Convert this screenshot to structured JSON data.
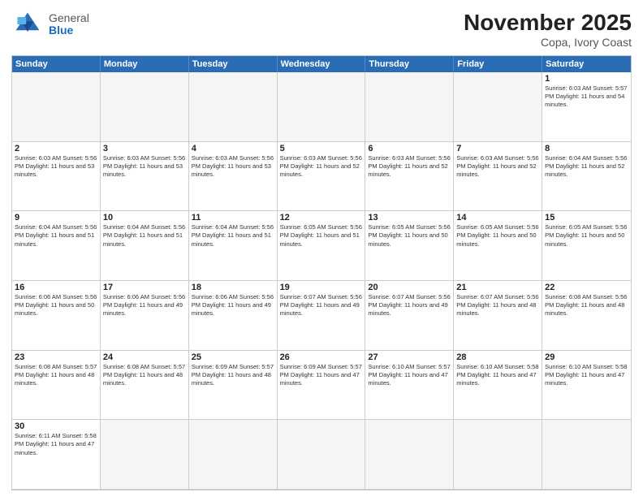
{
  "header": {
    "logo": {
      "general": "General",
      "blue": "Blue"
    },
    "title": "November 2025",
    "location": "Copa, Ivory Coast"
  },
  "days": [
    "Sunday",
    "Monday",
    "Tuesday",
    "Wednesday",
    "Thursday",
    "Friday",
    "Saturday"
  ],
  "cells": [
    {
      "day": "",
      "info": ""
    },
    {
      "day": "",
      "info": ""
    },
    {
      "day": "",
      "info": ""
    },
    {
      "day": "",
      "info": ""
    },
    {
      "day": "",
      "info": ""
    },
    {
      "day": "",
      "info": ""
    },
    {
      "day": "1",
      "info": "Sunrise: 6:03 AM\nSunset: 5:57 PM\nDaylight: 11 hours\nand 54 minutes."
    },
    {
      "day": "2",
      "info": "Sunrise: 6:03 AM\nSunset: 5:56 PM\nDaylight: 11 hours\nand 53 minutes."
    },
    {
      "day": "3",
      "info": "Sunrise: 6:03 AM\nSunset: 5:56 PM\nDaylight: 11 hours\nand 53 minutes."
    },
    {
      "day": "4",
      "info": "Sunrise: 6:03 AM\nSunset: 5:56 PM\nDaylight: 11 hours\nand 53 minutes."
    },
    {
      "day": "5",
      "info": "Sunrise: 6:03 AM\nSunset: 5:56 PM\nDaylight: 11 hours\nand 52 minutes."
    },
    {
      "day": "6",
      "info": "Sunrise: 6:03 AM\nSunset: 5:56 PM\nDaylight: 11 hours\nand 52 minutes."
    },
    {
      "day": "7",
      "info": "Sunrise: 6:03 AM\nSunset: 5:56 PM\nDaylight: 11 hours\nand 52 minutes."
    },
    {
      "day": "8",
      "info": "Sunrise: 6:04 AM\nSunset: 5:56 PM\nDaylight: 11 hours\nand 52 minutes."
    },
    {
      "day": "9",
      "info": "Sunrise: 6:04 AM\nSunset: 5:56 PM\nDaylight: 11 hours\nand 51 minutes."
    },
    {
      "day": "10",
      "info": "Sunrise: 6:04 AM\nSunset: 5:56 PM\nDaylight: 11 hours\nand 51 minutes."
    },
    {
      "day": "11",
      "info": "Sunrise: 6:04 AM\nSunset: 5:56 PM\nDaylight: 11 hours\nand 51 minutes."
    },
    {
      "day": "12",
      "info": "Sunrise: 6:05 AM\nSunset: 5:56 PM\nDaylight: 11 hours\nand 51 minutes."
    },
    {
      "day": "13",
      "info": "Sunrise: 6:05 AM\nSunset: 5:56 PM\nDaylight: 11 hours\nand 50 minutes."
    },
    {
      "day": "14",
      "info": "Sunrise: 6:05 AM\nSunset: 5:56 PM\nDaylight: 11 hours\nand 50 minutes."
    },
    {
      "day": "15",
      "info": "Sunrise: 6:05 AM\nSunset: 5:56 PM\nDaylight: 11 hours\nand 50 minutes."
    },
    {
      "day": "16",
      "info": "Sunrise: 6:06 AM\nSunset: 5:56 PM\nDaylight: 11 hours\nand 50 minutes."
    },
    {
      "day": "17",
      "info": "Sunrise: 6:06 AM\nSunset: 5:56 PM\nDaylight: 11 hours\nand 49 minutes."
    },
    {
      "day": "18",
      "info": "Sunrise: 6:06 AM\nSunset: 5:56 PM\nDaylight: 11 hours\nand 49 minutes."
    },
    {
      "day": "19",
      "info": "Sunrise: 6:07 AM\nSunset: 5:56 PM\nDaylight: 11 hours\nand 49 minutes."
    },
    {
      "day": "20",
      "info": "Sunrise: 6:07 AM\nSunset: 5:56 PM\nDaylight: 11 hours\nand 49 minutes."
    },
    {
      "day": "21",
      "info": "Sunrise: 6:07 AM\nSunset: 5:56 PM\nDaylight: 11 hours\nand 48 minutes."
    },
    {
      "day": "22",
      "info": "Sunrise: 6:08 AM\nSunset: 5:56 PM\nDaylight: 11 hours\nand 48 minutes."
    },
    {
      "day": "23",
      "info": "Sunrise: 6:08 AM\nSunset: 5:57 PM\nDaylight: 11 hours\nand 48 minutes."
    },
    {
      "day": "24",
      "info": "Sunrise: 6:08 AM\nSunset: 5:57 PM\nDaylight: 11 hours\nand 48 minutes."
    },
    {
      "day": "25",
      "info": "Sunrise: 6:09 AM\nSunset: 5:57 PM\nDaylight: 11 hours\nand 48 minutes."
    },
    {
      "day": "26",
      "info": "Sunrise: 6:09 AM\nSunset: 5:57 PM\nDaylight: 11 hours\nand 47 minutes."
    },
    {
      "day": "27",
      "info": "Sunrise: 6:10 AM\nSunset: 5:57 PM\nDaylight: 11 hours\nand 47 minutes."
    },
    {
      "day": "28",
      "info": "Sunrise: 6:10 AM\nSunset: 5:58 PM\nDaylight: 11 hours\nand 47 minutes."
    },
    {
      "day": "29",
      "info": "Sunrise: 6:10 AM\nSunset: 5:58 PM\nDaylight: 11 hours\nand 47 minutes."
    },
    {
      "day": "30",
      "info": "Sunrise: 6:11 AM\nSunset: 5:58 PM\nDaylight: 11 hours\nand 47 minutes."
    },
    {
      "day": "",
      "info": ""
    },
    {
      "day": "",
      "info": ""
    },
    {
      "day": "",
      "info": ""
    },
    {
      "day": "",
      "info": ""
    },
    {
      "day": "",
      "info": ""
    },
    {
      "day": "",
      "info": ""
    }
  ]
}
